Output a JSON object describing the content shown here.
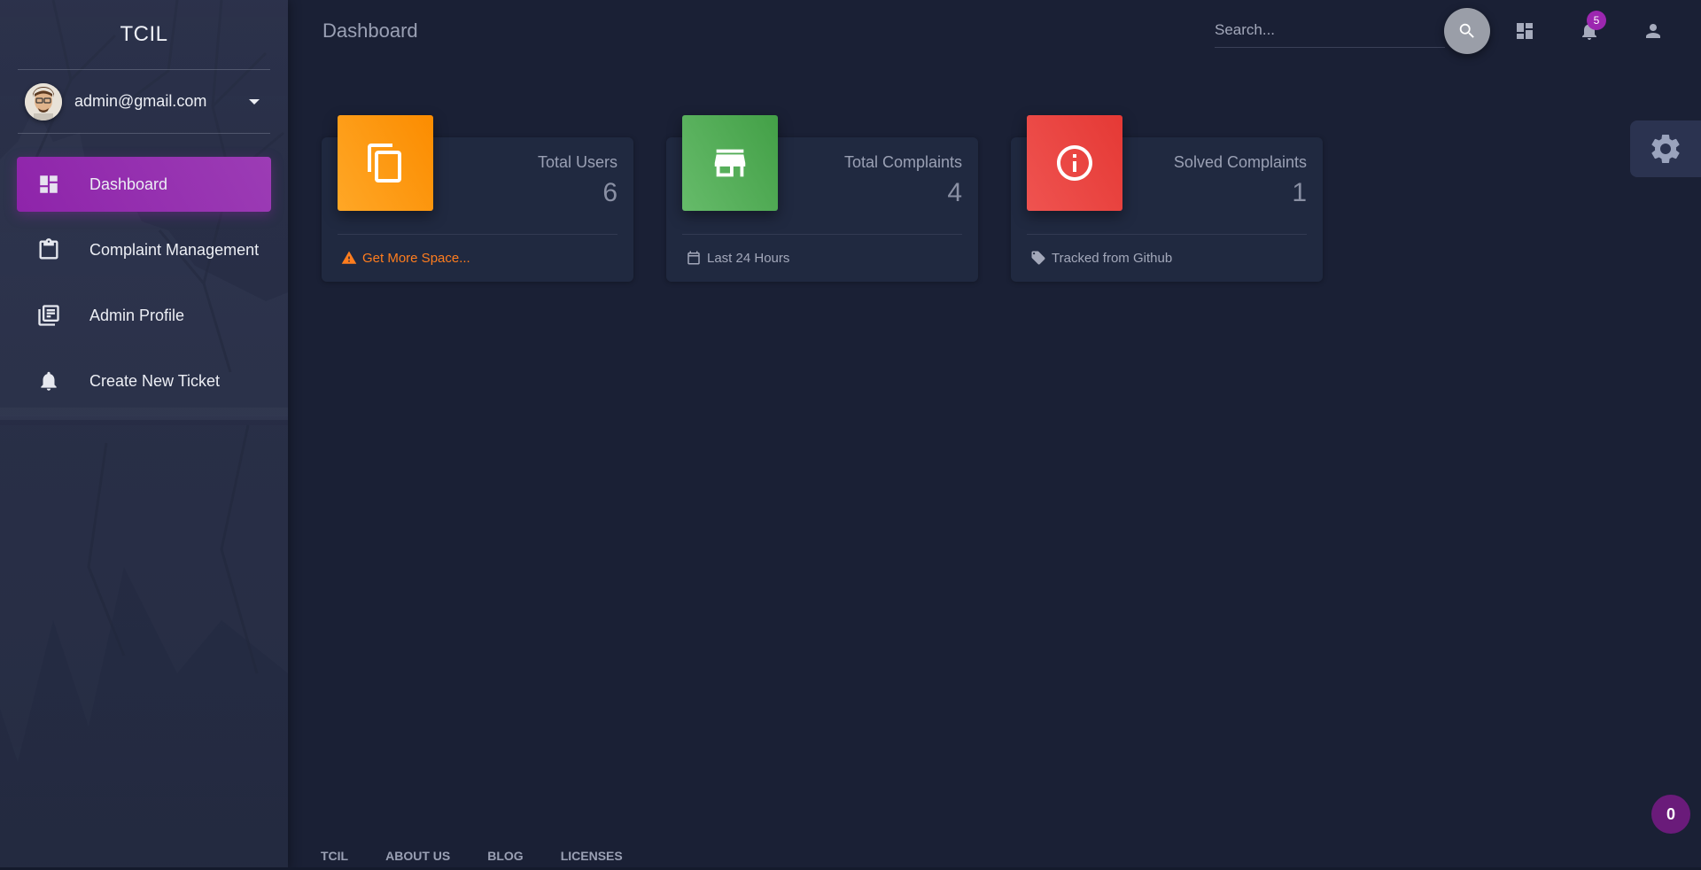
{
  "brand": {
    "name": "TCIL"
  },
  "user": {
    "email": "admin@gmail.com",
    "avatar_icon": "user-avatar-icon"
  },
  "sidebar": {
    "items": [
      {
        "label": "Dashboard",
        "icon": "dashboard-icon",
        "active": true
      },
      {
        "label": "Complaint Management",
        "icon": "clipboard-icon",
        "active": false
      },
      {
        "label": "Admin Profile",
        "icon": "library-books-icon",
        "active": false
      },
      {
        "label": "Create New Ticket",
        "icon": "bell-icon",
        "active": false
      }
    ]
  },
  "header": {
    "title": "Dashboard",
    "search_placeholder": "Search...",
    "notification_count": "5"
  },
  "cards": [
    {
      "category": "Total Users",
      "value": "6",
      "footer": "Get More Space...",
      "footer_icon": "warning-icon",
      "icon": "content-copy-icon",
      "color": "#fb8c00"
    },
    {
      "category": "Total Complaints",
      "value": "4",
      "footer": "Last 24 Hours",
      "footer_icon": "calendar-icon",
      "icon": "store-icon",
      "color": "#43a047"
    },
    {
      "category": "Solved Complaints",
      "value": "1",
      "footer": "Tracked from Github",
      "footer_icon": "tag-icon",
      "icon": "info-outline-icon",
      "color": "#e53935"
    }
  ],
  "footer": {
    "links": [
      "TCIL",
      "About Us",
      "Blog",
      "Licenses"
    ]
  },
  "chat_bubble": {
    "count": "0"
  },
  "colors": {
    "background": "#1a2035",
    "sidebar_active": "#9c27b0",
    "card_bg": "#202940"
  }
}
